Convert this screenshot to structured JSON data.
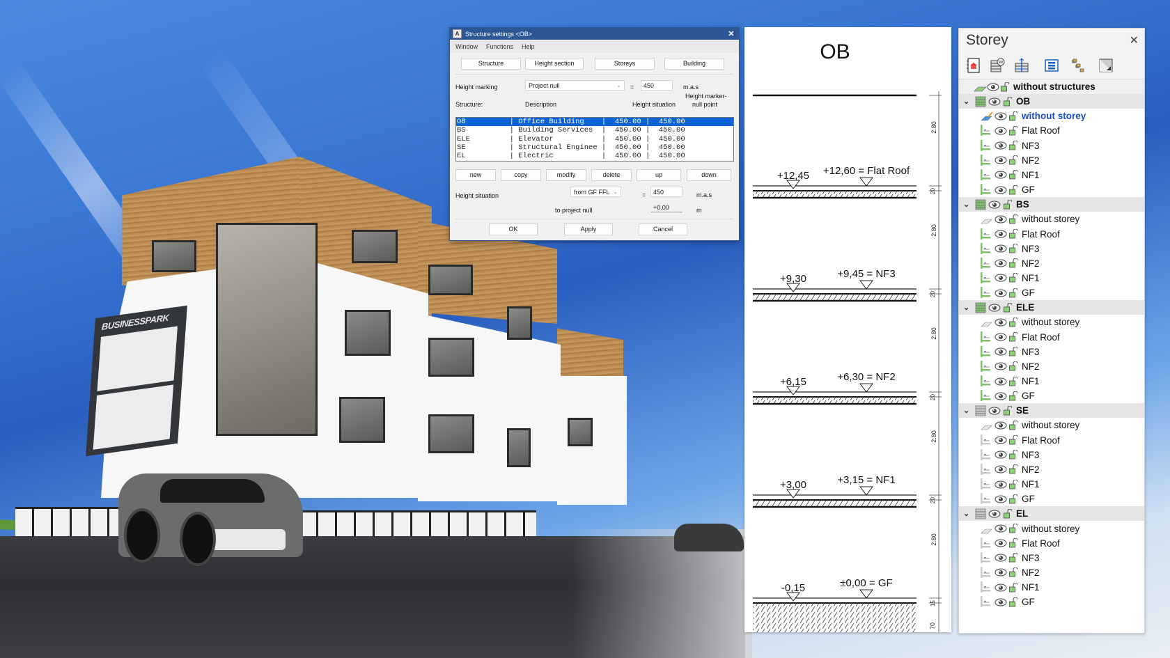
{
  "scene": {
    "sign_text": "BUSINESSPARK"
  },
  "dialog": {
    "title": "Structure settings <OB>",
    "close_label": "✕",
    "app_icon": "A",
    "menu": [
      "Window",
      "Functions",
      "Help"
    ],
    "tabs": [
      "Structure",
      "Height section",
      "Storeys",
      "Building"
    ],
    "height_marking": {
      "label": "Height marking",
      "select_value": "Project null",
      "equals": "=",
      "value": "450",
      "unit": "m.a.s"
    },
    "list_headers": {
      "structure": "Structure:",
      "description": "Description",
      "height_situation": "Height situation",
      "height_marker_line1": "Height marker-",
      "height_marker_line2": "null point"
    },
    "structures": [
      {
        "code": "OB",
        "description": "Office Building",
        "height_situation": "450.00",
        "null_point": "450.00",
        "selected": true
      },
      {
        "code": "BS",
        "description": "Building Services",
        "height_situation": "450.00",
        "null_point": "450.00",
        "selected": false
      },
      {
        "code": "ELE",
        "description": "Elevator",
        "height_situation": "450.00",
        "null_point": "450.00",
        "selected": false
      },
      {
        "code": "SE",
        "description": "Structural Enginee",
        "height_situation": "450.00",
        "null_point": "450.00",
        "selected": false
      },
      {
        "code": "EL",
        "description": "Electric",
        "height_situation": "450.00",
        "null_point": "450.00",
        "selected": false
      }
    ],
    "list_buttons": [
      "new",
      "copy",
      "modify",
      "delete",
      "up",
      "down"
    ],
    "height_situation": {
      "label": "Height situation",
      "select_value": "from GF FFL",
      "equals": "=",
      "value": "450",
      "unit": "m.a.s",
      "to_project_null_label": "to project null",
      "to_project_null_value": "+0.00",
      "to_project_null_unit": "m"
    },
    "footer_buttons": [
      "OK",
      "Apply",
      "Cancel"
    ]
  },
  "section": {
    "title": "OB",
    "levels": [
      {
        "raw": "+12,45",
        "finished": "+12,60 = Flat Roof"
      },
      {
        "raw": "+9,30",
        "finished": "+9,45 = NF3"
      },
      {
        "raw": "+6,15",
        "finished": "+6,30 = NF2"
      },
      {
        "raw": "+3,00",
        "finished": "+3,15 = NF1"
      },
      {
        "raw": "-0,15",
        "finished": "±0,00 = GF"
      }
    ],
    "dimensions": {
      "storey_height": "2.80",
      "slab_a": "20",
      "slab_b": "15",
      "foundation": "70"
    }
  },
  "storey_panel": {
    "title": "Storey",
    "close_label": "✕",
    "toolbar_icons": [
      "storey-book-icon",
      "storey-swap-icon",
      "storey-height-icon",
      "list-icon",
      "tree-structure-icon",
      "section-icon"
    ],
    "top_item": "without structures",
    "groups": [
      {
        "name": "OB",
        "expanded": true,
        "items": [
          "without storey",
          "Flat Roof",
          "NF3",
          "NF2",
          "NF1",
          "GF"
        ],
        "active_item": "without storey",
        "color": "#7fbf6a"
      },
      {
        "name": "BS",
        "expanded": true,
        "items": [
          "without storey",
          "Flat Roof",
          "NF3",
          "NF2",
          "NF1",
          "GF"
        ],
        "active_item": "",
        "color": "#7fbf6a"
      },
      {
        "name": "ELE",
        "expanded": true,
        "items": [
          "without storey",
          "Flat Roof",
          "NF3",
          "NF2",
          "NF1",
          "GF"
        ],
        "active_item": "",
        "color": "#7fbf6a"
      },
      {
        "name": "SE",
        "expanded": true,
        "items": [
          "without storey",
          "Flat Roof",
          "NF3",
          "NF2",
          "NF1",
          "GF"
        ],
        "active_item": "",
        "color": "#c8c8c8"
      },
      {
        "name": "EL",
        "expanded": true,
        "items": [
          "without storey",
          "Flat Roof",
          "NF3",
          "NF2",
          "NF1",
          "GF"
        ],
        "active_item": "",
        "color": "#c8c8c8"
      }
    ]
  }
}
